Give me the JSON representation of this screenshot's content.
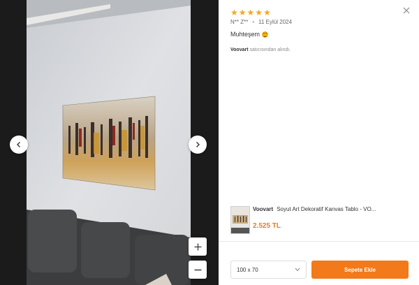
{
  "review": {
    "rating": 5,
    "stars": [
      "★",
      "★",
      "★",
      "★",
      "★"
    ],
    "author": "N** Z**",
    "date": "11 Eylül 2024",
    "comment": "Muhteşem",
    "seller_name": "Voovart",
    "seller_suffix": "satıcısından alındı."
  },
  "product": {
    "brand": "Voovart",
    "name": "Soyut Art Dekoratif Kanvas Tablo - VO...",
    "price": "2.525 TL"
  },
  "purchase": {
    "size_selected": "100 x 70",
    "cta_label": "Sepete Ekle"
  },
  "icons": {
    "prev": "chevron-left-icon",
    "next": "chevron-right-icon",
    "zoom_in": "plus-icon",
    "zoom_out": "minus-icon",
    "close": "close-icon",
    "dropdown": "chevron-down-icon",
    "emoji": "smiling-face-icon"
  },
  "colors": {
    "accent": "#f27a1a",
    "star": "#f5a623",
    "viewer_bg": "#1b1b1b"
  }
}
